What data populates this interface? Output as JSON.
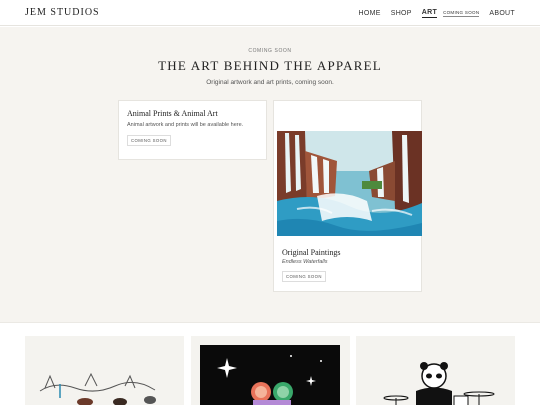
{
  "header": {
    "brand": "JEM STUDIOS",
    "nav": {
      "home": "HOME",
      "shop": "SHOP",
      "art": "ART",
      "art_badge": "COMING SOON",
      "about": "ABOUT"
    }
  },
  "hero": {
    "eyebrow": "COMING SOON",
    "title": "THE ART BEHIND THE APPAREL",
    "subtitle": "Original artwork and art prints, coming soon."
  },
  "cards": [
    {
      "title": "Animal Prints & Animal Art",
      "description": "Animal artwork and prints will be available here.",
      "status": "COMING SOON"
    },
    {
      "title": "Original Paintings",
      "subtitle": "Endless Waterfalls",
      "status": "COMING SOON"
    }
  ],
  "colors": {
    "hero_bg": "#f6f4f0",
    "water": "#2f9cc4",
    "cliff": "#7a3c2a"
  }
}
